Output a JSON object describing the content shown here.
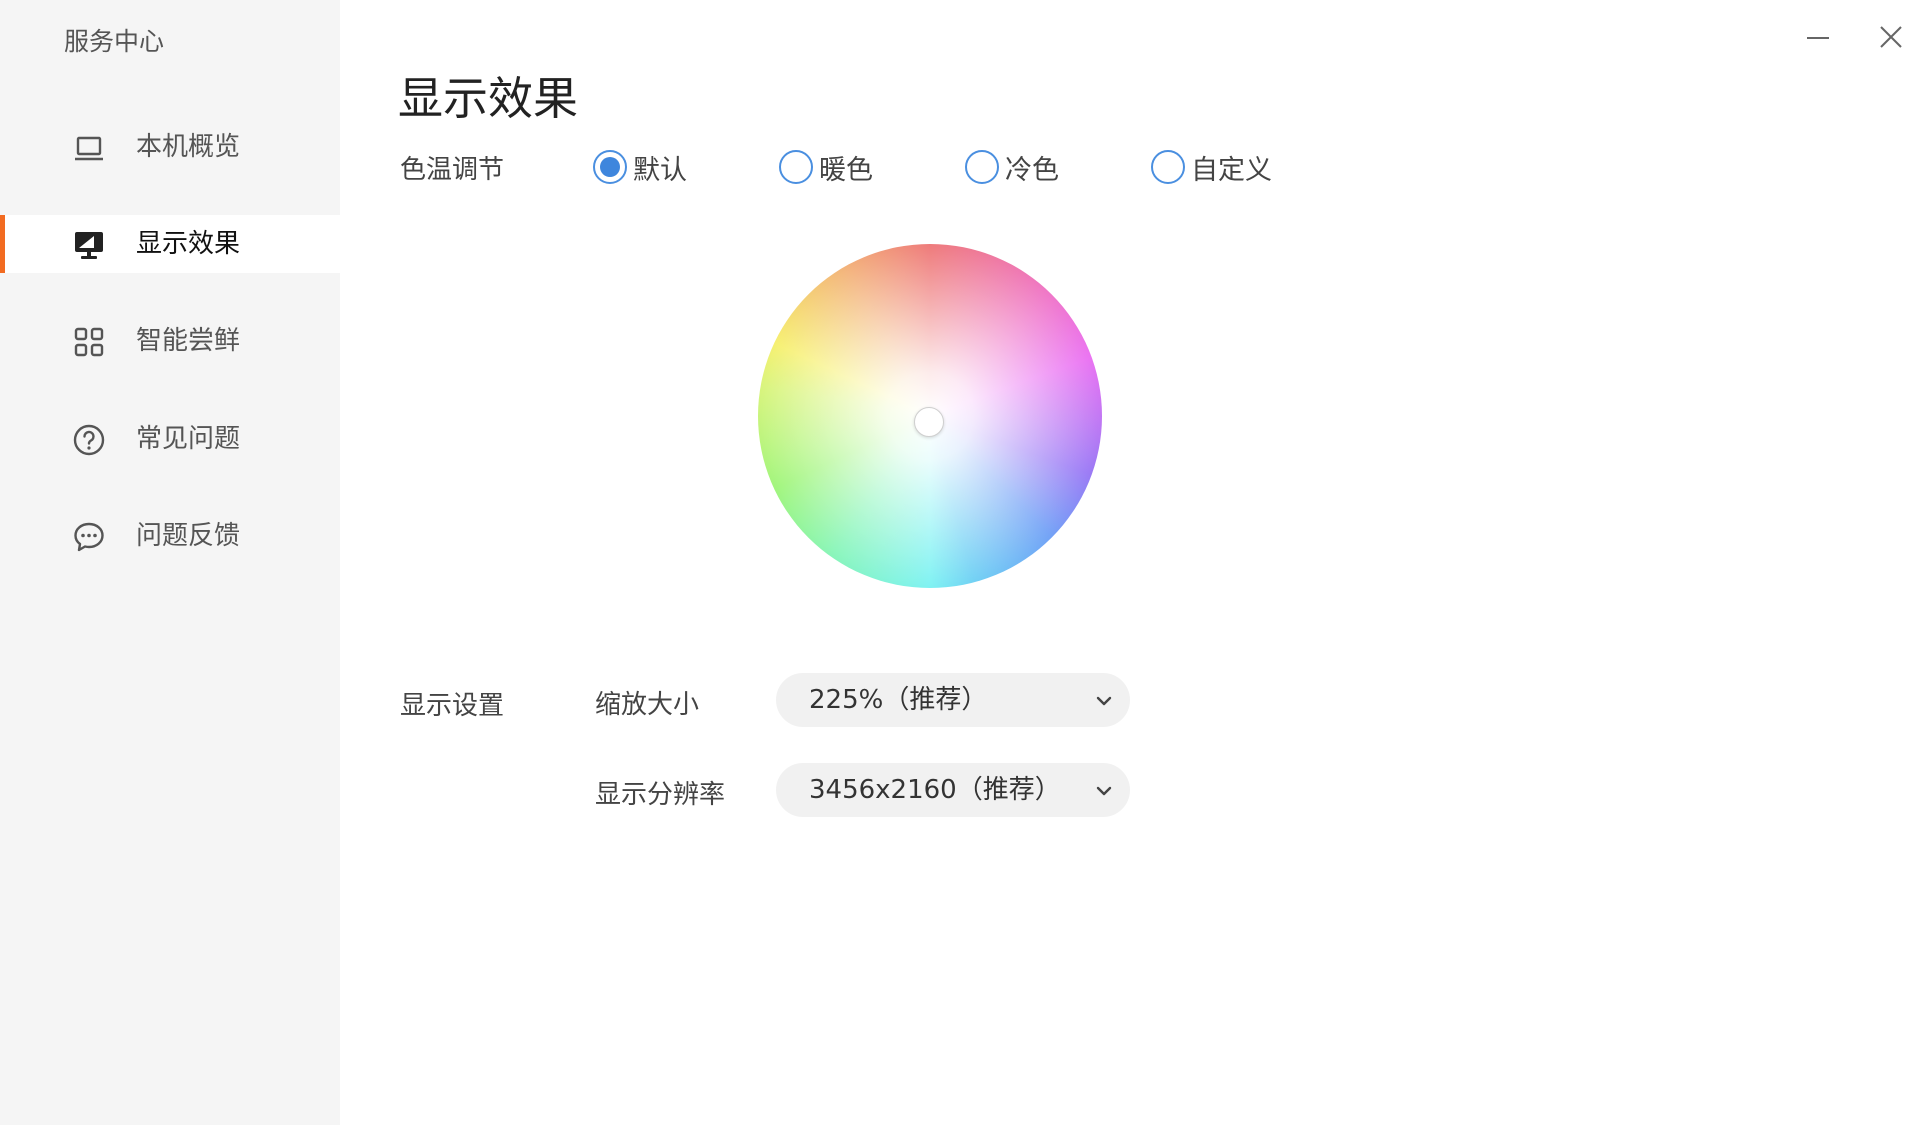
{
  "window": {
    "app_title": "服务中心"
  },
  "sidebar": {
    "items": [
      {
        "label": "本机概览",
        "icon": "laptop-icon"
      },
      {
        "label": "显示效果",
        "icon": "monitor-icon",
        "active": true
      },
      {
        "label": "智能尝鲜",
        "icon": "grid-icon"
      },
      {
        "label": "常见问题",
        "icon": "help-circle-icon"
      },
      {
        "label": "问题反馈",
        "icon": "chat-bubble-icon"
      }
    ]
  },
  "main": {
    "title": "显示效果",
    "color_temp": {
      "label": "色温调节",
      "options": [
        {
          "label": "默认",
          "selected": true
        },
        {
          "label": "暖色",
          "selected": false
        },
        {
          "label": "冷色",
          "selected": false
        },
        {
          "label": "自定义",
          "selected": false
        }
      ]
    },
    "display": {
      "label": "显示设置",
      "scale": {
        "label": "缩放大小",
        "value": "225%（推荐）"
      },
      "resolution": {
        "label": "显示分辨率",
        "value": "3456x2160（推荐）"
      }
    }
  },
  "colors": {
    "accent": "#3e86dd",
    "active_marker": "#f26b21",
    "sidebar_bg": "#f5f5f5"
  }
}
